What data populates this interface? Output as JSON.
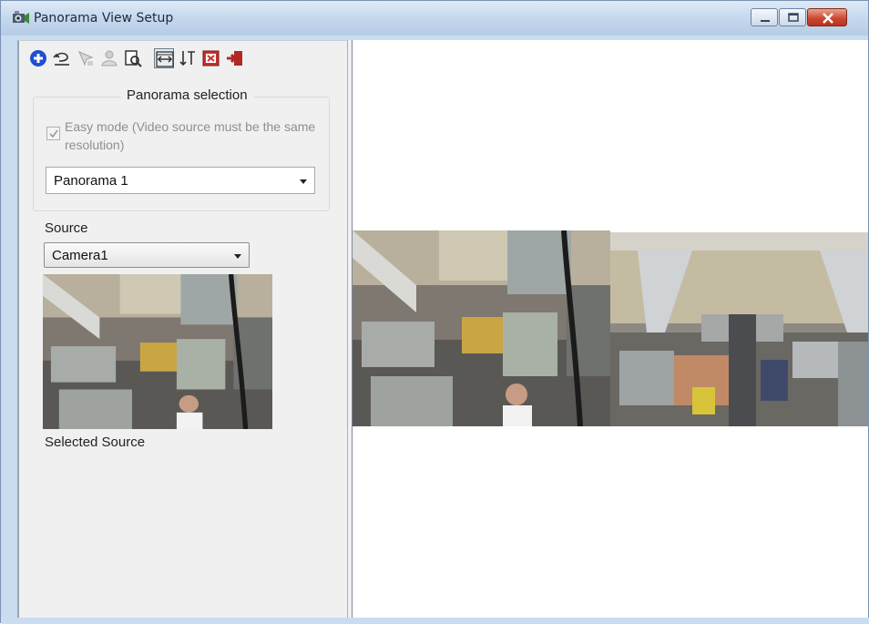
{
  "window": {
    "title": "Panorama View Setup",
    "buttons": [
      "minimize",
      "maximize",
      "close"
    ]
  },
  "toolbar": {
    "icons": [
      "add-icon",
      "undo-icon",
      "move-icon",
      "user-icon",
      "preview-icon",
      "fit-width-icon",
      "sort-icon",
      "record-icon",
      "exit-icon"
    ]
  },
  "panorama_selection": {
    "group_title": "Panorama selection",
    "easy_mode_label": "Easy mode (Video source must be the same resolution)",
    "easy_mode_checked": true,
    "selected_panorama": "Panorama 1"
  },
  "source": {
    "label": "Source",
    "selected_camera": "Camera1",
    "caption": "Selected Source"
  },
  "colors": {
    "panel_bg": "#f0f0f0",
    "titlebar": "#c9dcf0",
    "close_button": "#c9452c"
  }
}
